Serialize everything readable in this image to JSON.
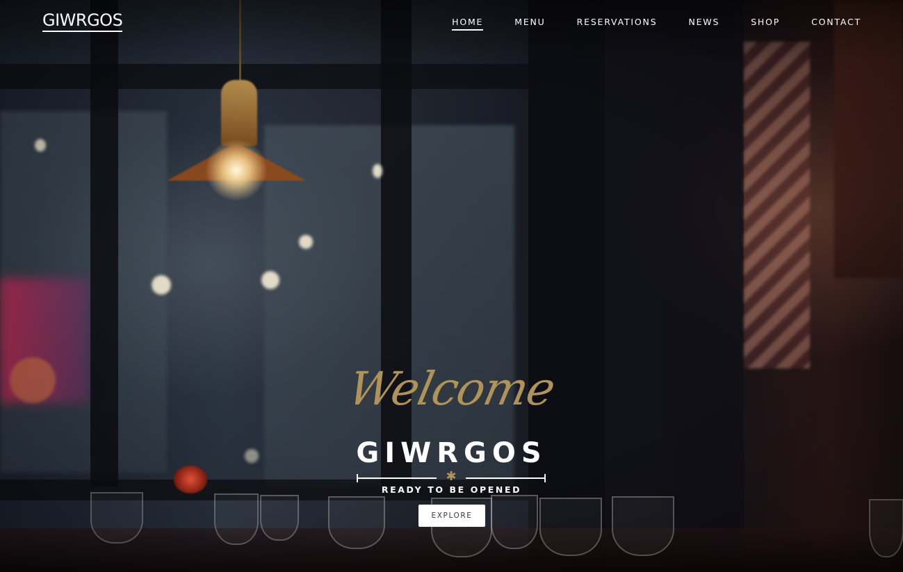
{
  "header": {
    "logo_text": "GIWRGOS",
    "nav": [
      {
        "label": "HOME",
        "active": true
      },
      {
        "label": "MENU",
        "active": false
      },
      {
        "label": "RESERVATIONS",
        "active": false
      },
      {
        "label": "NEWS",
        "active": false
      },
      {
        "label": "SHOP",
        "active": false
      },
      {
        "label": "CONTACT",
        "active": false
      }
    ]
  },
  "hero": {
    "script_heading": "Welcome",
    "title": "GIWRGOS",
    "divider_icon": "asterisk-ornament",
    "tagline": "READY TO BE OPENED",
    "cta_label": "EXPLORE"
  },
  "colors": {
    "accent_gold": "#b0935a",
    "text": "#ffffff",
    "button_bg": "#ffffff",
    "button_text": "#3a3a3a"
  },
  "background": "restaurant-interior-photo"
}
